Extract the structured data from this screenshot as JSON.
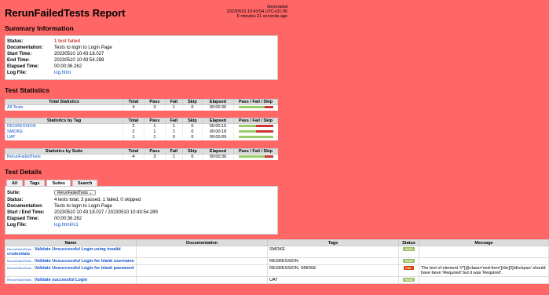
{
  "report": {
    "title": "RerunFailedTests Report",
    "generated_label": "Generated",
    "generated_at": "20230510 10:43:54 UTC+01:00",
    "generated_ago": "6 minutes 21 seconds ago"
  },
  "summary": {
    "heading": "Summary Information",
    "rows": [
      {
        "label": "Status:",
        "value": "1 test failed"
      },
      {
        "label": "Documentation:",
        "value": "Tests to login to Login Page"
      },
      {
        "label": "Start Time:",
        "value": "20230510 10:43:18.027"
      },
      {
        "label": "End Time:",
        "value": "20230510 10:43:54.289"
      },
      {
        "label": "Elapsed Time:",
        "value": "00:00:36.262"
      },
      {
        "label": "Log File:",
        "value": "log.html"
      }
    ]
  },
  "statistics": {
    "heading": "Test Statistics",
    "columns": [
      "Total",
      "Pass",
      "Fail",
      "Skip",
      "Elapsed",
      "Pass / Fail / Skip"
    ],
    "total": {
      "header": "Total Statistics",
      "rows": [
        {
          "name": "All Tests",
          "total": "4",
          "pass": "3",
          "fail": "1",
          "skip": "0",
          "elapsed": "00:00:36",
          "ratio": 0.75
        }
      ]
    },
    "by_tag": {
      "header": "Statistics by Tag",
      "rows": [
        {
          "name": "REGRESSION",
          "total": "2",
          "pass": "1",
          "fail": "1",
          "skip": "0",
          "elapsed": "00:00:15",
          "ratio": 0.5
        },
        {
          "name": "SMOKE",
          "total": "2",
          "pass": "1",
          "fail": "1",
          "skip": "0",
          "elapsed": "00:00:18",
          "ratio": 0.5
        },
        {
          "name": "UAT",
          "total": "1",
          "pass": "1",
          "fail": "0",
          "skip": "0",
          "elapsed": "00:00:09",
          "ratio": 1.0
        }
      ]
    },
    "by_suite": {
      "header": "Statistics by Suite",
      "rows": [
        {
          "name": "RerunFailedTests",
          "total": "4",
          "pass": "3",
          "fail": "1",
          "skip": "0",
          "elapsed": "00:00:36",
          "ratio": 0.75
        }
      ]
    }
  },
  "details": {
    "heading": "Test Details",
    "tabs": [
      "All",
      "Tags",
      "Suites",
      "Search"
    ],
    "active_tab": "Suites",
    "suite_label": "Suite:",
    "suite_value": "RerunFailedTests",
    "rows": [
      {
        "label": "Status:",
        "value": "4 tests total, 3 passed, 1 failed, 0 skipped"
      },
      {
        "label": "Documentation:",
        "value": "Tests to login to Login Page"
      },
      {
        "label": "Start / End Time:",
        "value": "20230510 10:43:18.027 / 20230510 10:43:54.289"
      },
      {
        "label": "Elapsed Time:",
        "value": "00:00:36.262"
      },
      {
        "label": "Log File:",
        "value": "log.html#s1"
      }
    ]
  },
  "tests": {
    "columns": [
      "Name",
      "Documentation",
      "Tags",
      "Status",
      "Message"
    ],
    "rows": [
      {
        "parent": "RerunFailedTests .",
        "name": "Validate Unsuccessful Login using invalid credentials",
        "doc": "",
        "tags": "SMOKE",
        "status": "PASS",
        "message": ""
      },
      {
        "parent": "RerunFailedTests .",
        "name": "Validate Unsuccessful Login for blank username",
        "doc": "",
        "tags": "REGRESSION",
        "status": "PASS",
        "message": ""
      },
      {
        "parent": "RerunFailedTests .",
        "name": "Validate Unsuccessful Login for blank password",
        "doc": "",
        "tags": "REGRESSION, SMOKE",
        "status": "FAIL",
        "message": "The text of element '//*[@class='oxd-form']/div[2]/div/span' should have been 'Required' but it was 'Required'."
      },
      {
        "parent": "RerunFailedTests .",
        "name": "Validate successful Login",
        "doc": "",
        "tags": "UAT",
        "status": "PASS",
        "message": ""
      }
    ]
  },
  "colors": {
    "background": "#ff6666",
    "pass": "#97bd61",
    "fail": "#ce3e01",
    "link": "#1155cc"
  }
}
